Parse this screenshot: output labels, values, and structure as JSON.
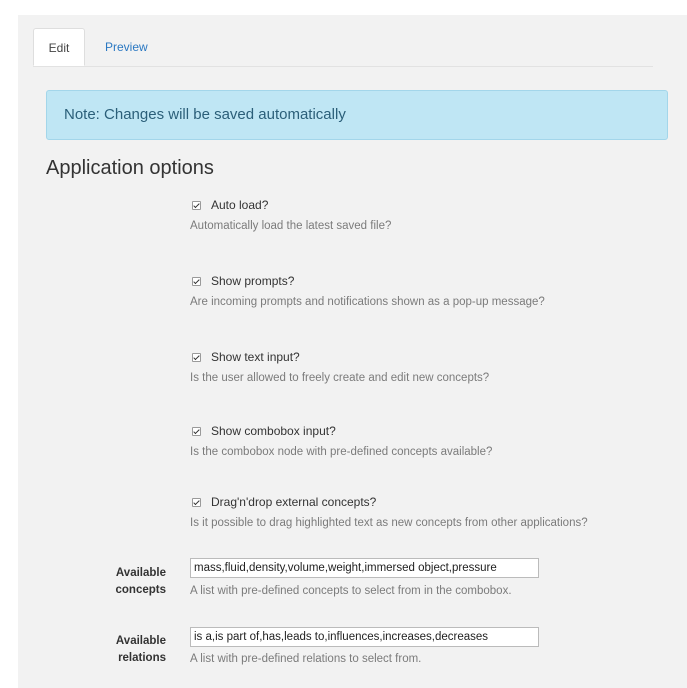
{
  "tabs": {
    "edit": "Edit",
    "preview": "Preview"
  },
  "note": "Note: Changes will be saved automatically",
  "heading": "Application options",
  "options": [
    {
      "label": "Auto load?",
      "help": "Automatically load the latest saved file?",
      "checked": true
    },
    {
      "label": "Show prompts?",
      "help": "Are incoming prompts and notifications shown as a pop-up message?",
      "checked": true
    },
    {
      "label": "Show text input?",
      "help": "Is the user allowed to freely create and edit new concepts?",
      "checked": true
    },
    {
      "label": "Show combobox input?",
      "help": "Is the combobox node with pre-defined concepts available?",
      "checked": true
    },
    {
      "label": "Drag'n'drop external concepts?",
      "help": "Is it possible to drag highlighted text as new concepts from other applications?",
      "checked": true
    }
  ],
  "fields": {
    "concepts": {
      "label_line1": "Available",
      "label_line2": "concepts",
      "value": "mass,fluid,density,volume,weight,immersed object,pressure",
      "help": "A list with pre-defined concepts to select from in the combobox."
    },
    "relations": {
      "label_line1": "Available",
      "label_line2": "relations",
      "value": "is a,is part of,has,leads to,influences,increases,decreases",
      "help": "A list with pre-defined relations to select from."
    }
  }
}
